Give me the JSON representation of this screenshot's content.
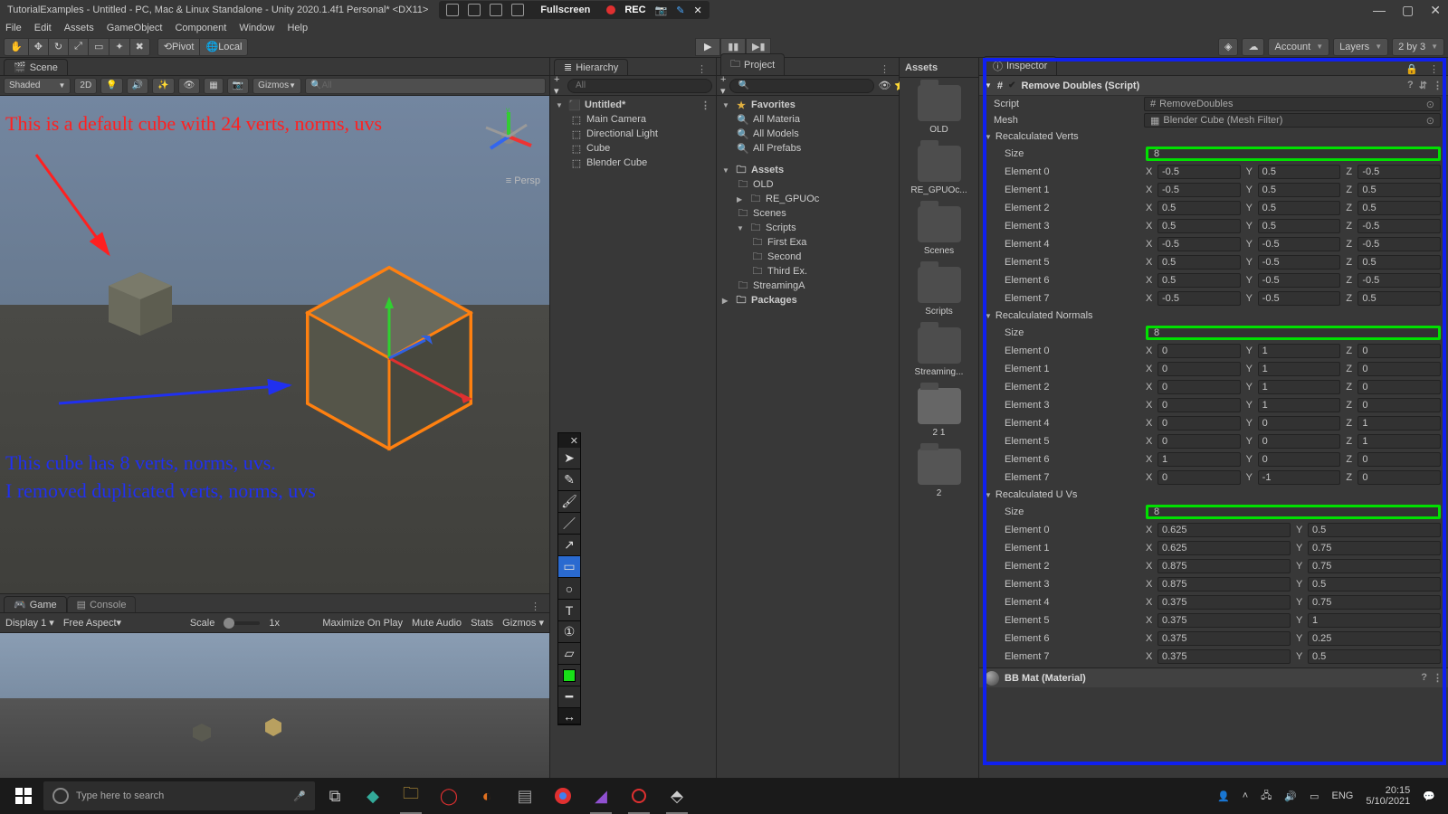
{
  "titlebar": {
    "title": "TutorialExamples - Untitled - PC, Mac & Linux Standalone - Unity 2020.1.4f1 Personal* <DX11>",
    "rec_fullscreen": "Fullscreen",
    "rec_text": "REC"
  },
  "menubar": [
    "File",
    "Edit",
    "Assets",
    "GameObject",
    "Component",
    "Window",
    "Help"
  ],
  "toolbar": {
    "pivot": "Pivot",
    "local": "Local",
    "account": "Account",
    "layers": "Layers",
    "layout": "2 by 3"
  },
  "scene": {
    "tab": "Scene",
    "shaded": "Shaded",
    "twod": "2D",
    "gizmos": "Gizmos",
    "search_ph": "All",
    "persp": "Persp",
    "annot_red": "This is a default cube with 24 verts, norms, uvs",
    "annot_blue1": "This cube has 8 verts, norms, uvs.",
    "annot_blue2": "I removed duplicated verts, norms, uvs"
  },
  "game": {
    "tab_game": "Game",
    "tab_console": "Console",
    "display": "Display 1",
    "aspect": "Free Aspect",
    "scale": "Scale",
    "scale_val": "1x",
    "max": "Maximize On Play",
    "mute": "Mute Audio",
    "stats": "Stats",
    "gizmos": "Gizmos"
  },
  "hierarchy": {
    "tab": "Hierarchy",
    "search_ph": "All",
    "scene_name": "Untitled*",
    "items": [
      "Main Camera",
      "Directional Light",
      "Cube",
      "Blender Cube"
    ]
  },
  "project": {
    "tab": "Project",
    "favorites": "Favorites",
    "fav_items": [
      "All Materia",
      "All Models",
      "All Prefabs"
    ],
    "assets": "Assets",
    "folders": [
      "OLD",
      "RE_GPUOc",
      "Scenes",
      "Scripts"
    ],
    "script_children": [
      "First Exa",
      "Second",
      "Third Ex.",
      "StreamingA"
    ],
    "packages": "Packages",
    "grid_header": "Assets",
    "grid_items": [
      "OLD",
      "RE_GPUOc...",
      "Scenes",
      "Scripts",
      "Streaming...",
      "2 1",
      "2"
    ]
  },
  "inspector": {
    "tab": "Inspector",
    "component_title": "Remove Doubles (Script)",
    "script_lbl": "Script",
    "script_val": "RemoveDoubles",
    "mesh_lbl": "Mesh",
    "mesh_val": "Blender Cube (Mesh Filter)",
    "verts_header": "Recalculated Verts",
    "size_lbl": "Size",
    "verts_size": "8",
    "verts": [
      {
        "x": "-0.5",
        "y": "0.5",
        "z": "-0.5"
      },
      {
        "x": "-0.5",
        "y": "0.5",
        "z": "0.5"
      },
      {
        "x": "0.5",
        "y": "0.5",
        "z": "0.5"
      },
      {
        "x": "0.5",
        "y": "0.5",
        "z": "-0.5"
      },
      {
        "x": "-0.5",
        "y": "-0.5",
        "z": "-0.5"
      },
      {
        "x": "0.5",
        "y": "-0.5",
        "z": "0.5"
      },
      {
        "x": "0.5",
        "y": "-0.5",
        "z": "-0.5"
      },
      {
        "x": "-0.5",
        "y": "-0.5",
        "z": "0.5"
      }
    ],
    "norms_header": "Recalculated Normals",
    "norms_size": "8",
    "norms": [
      {
        "x": "0",
        "y": "1",
        "z": "0"
      },
      {
        "x": "0",
        "y": "1",
        "z": "0"
      },
      {
        "x": "0",
        "y": "1",
        "z": "0"
      },
      {
        "x": "0",
        "y": "1",
        "z": "0"
      },
      {
        "x": "0",
        "y": "0",
        "z": "1"
      },
      {
        "x": "0",
        "y": "0",
        "z": "1"
      },
      {
        "x": "1",
        "y": "0",
        "z": "0"
      },
      {
        "x": "0",
        "y": "-1",
        "z": "0"
      }
    ],
    "uvs_header": "Recalculated U Vs",
    "uvs_size": "8",
    "uvs": [
      {
        "x": "0.625",
        "y": "0.5"
      },
      {
        "x": "0.625",
        "y": "0.75"
      },
      {
        "x": "0.875",
        "y": "0.75"
      },
      {
        "x": "0.875",
        "y": "0.5"
      },
      {
        "x": "0.375",
        "y": "0.75"
      },
      {
        "x": "0.375",
        "y": "1"
      },
      {
        "x": "0.375",
        "y": "0.25"
      },
      {
        "x": "0.375",
        "y": "0.5"
      }
    ],
    "material": "BB Mat (Material)"
  },
  "taskbar": {
    "search_ph": "Type here to search",
    "lang": "ENG",
    "time": "20:15",
    "date": "5/10/2021"
  }
}
